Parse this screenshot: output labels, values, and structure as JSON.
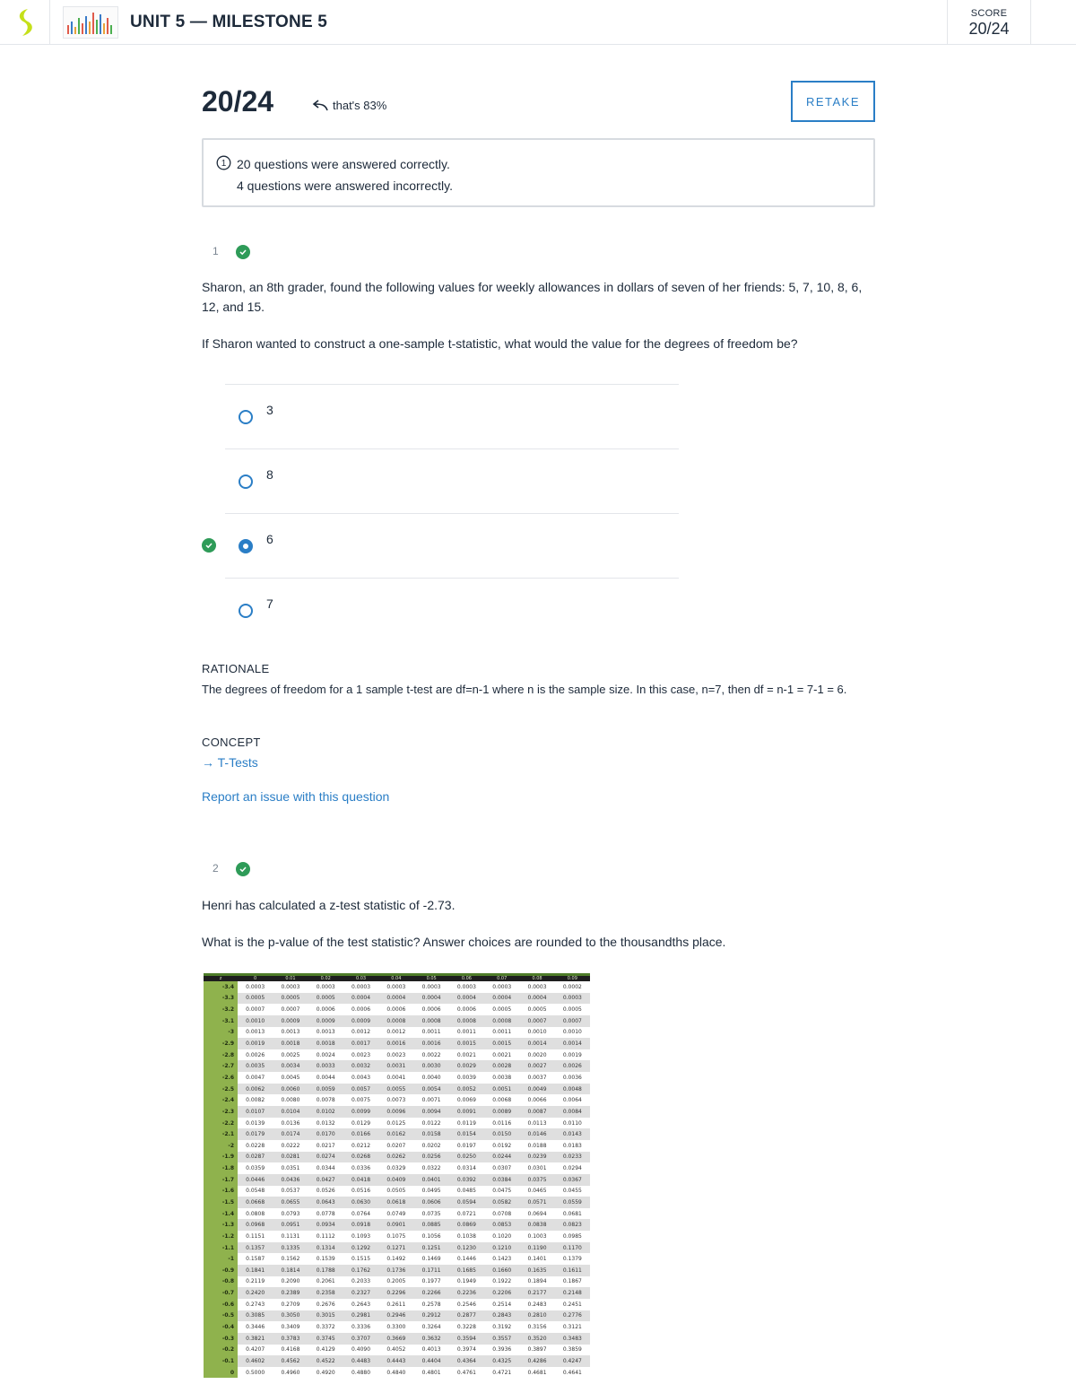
{
  "header": {
    "title": "UNIT 5 — MILESTONE 5",
    "score_label": "SCORE",
    "score_value": "20/24"
  },
  "result": {
    "score": "20/24",
    "percent_note": "that's 83%",
    "retake_label": "RETAKE",
    "correct_text": "20 questions were answered correctly.",
    "incorrect_text": "4 questions were answered incorrectly."
  },
  "question1": {
    "number": "1",
    "text": "Sharon, an 8th grader, found the following values for weekly allowances in dollars of seven of her friends: 5, 7, 10, 8, 6, 12, and 15.",
    "prompt": "If Sharon wanted to construct a one-sample t-statistic, what would the value for the degrees of freedom be?",
    "options": [
      {
        "label": "3",
        "selected": false
      },
      {
        "label": "8",
        "selected": false
      },
      {
        "label": "6",
        "selected": true
      },
      {
        "label": "7",
        "selected": false
      }
    ],
    "rationale_label": "RATIONALE",
    "rationale": "The degrees of freedom for a 1 sample t-test are df=n-1 where n is the sample size.  In this case, n=7, then df = n-1 = 7-1 = 6.",
    "concept_label": "CONCEPT",
    "concept_link": "T-Tests",
    "report_link": "Report an issue with this question"
  },
  "question2": {
    "number": "2",
    "text": "Henri has calculated a z-test statistic of -2.73.",
    "prompt": "What is the p-value of the test statistic?  Answer choices are rounded to the thousandths place."
  },
  "ztable": {
    "headers": [
      "z",
      "0",
      "0.01",
      "0.02",
      "0.03",
      "0.04",
      "0.05",
      "0.06",
      "0.07",
      "0.08",
      "0.09"
    ],
    "rows": [
      [
        "-3.4",
        "0.0003",
        "0.0003",
        "0.0003",
        "0.0003",
        "0.0003",
        "0.0003",
        "0.0003",
        "0.0003",
        "0.0003",
        "0.0002"
      ],
      [
        "-3.3",
        "0.0005",
        "0.0005",
        "0.0005",
        "0.0004",
        "0.0004",
        "0.0004",
        "0.0004",
        "0.0004",
        "0.0004",
        "0.0003"
      ],
      [
        "-3.2",
        "0.0007",
        "0.0007",
        "0.0006",
        "0.0006",
        "0.0006",
        "0.0006",
        "0.0006",
        "0.0005",
        "0.0005",
        "0.0005"
      ],
      [
        "-3.1",
        "0.0010",
        "0.0009",
        "0.0009",
        "0.0009",
        "0.0008",
        "0.0008",
        "0.0008",
        "0.0008",
        "0.0007",
        "0.0007"
      ],
      [
        "-3",
        "0.0013",
        "0.0013",
        "0.0013",
        "0.0012",
        "0.0012",
        "0.0011",
        "0.0011",
        "0.0011",
        "0.0010",
        "0.0010"
      ],
      [
        "-2.9",
        "0.0019",
        "0.0018",
        "0.0018",
        "0.0017",
        "0.0016",
        "0.0016",
        "0.0015",
        "0.0015",
        "0.0014",
        "0.0014"
      ],
      [
        "-2.8",
        "0.0026",
        "0.0025",
        "0.0024",
        "0.0023",
        "0.0023",
        "0.0022",
        "0.0021",
        "0.0021",
        "0.0020",
        "0.0019"
      ],
      [
        "-2.7",
        "0.0035",
        "0.0034",
        "0.0033",
        "0.0032",
        "0.0031",
        "0.0030",
        "0.0029",
        "0.0028",
        "0.0027",
        "0.0026"
      ],
      [
        "-2.6",
        "0.0047",
        "0.0045",
        "0.0044",
        "0.0043",
        "0.0041",
        "0.0040",
        "0.0039",
        "0.0038",
        "0.0037",
        "0.0036"
      ],
      [
        "-2.5",
        "0.0062",
        "0.0060",
        "0.0059",
        "0.0057",
        "0.0055",
        "0.0054",
        "0.0052",
        "0.0051",
        "0.0049",
        "0.0048"
      ],
      [
        "-2.4",
        "0.0082",
        "0.0080",
        "0.0078",
        "0.0075",
        "0.0073",
        "0.0071",
        "0.0069",
        "0.0068",
        "0.0066",
        "0.0064"
      ],
      [
        "-2.3",
        "0.0107",
        "0.0104",
        "0.0102",
        "0.0099",
        "0.0096",
        "0.0094",
        "0.0091",
        "0.0089",
        "0.0087",
        "0.0084"
      ],
      [
        "-2.2",
        "0.0139",
        "0.0136",
        "0.0132",
        "0.0129",
        "0.0125",
        "0.0122",
        "0.0119",
        "0.0116",
        "0.0113",
        "0.0110"
      ],
      [
        "-2.1",
        "0.0179",
        "0.0174",
        "0.0170",
        "0.0166",
        "0.0162",
        "0.0158",
        "0.0154",
        "0.0150",
        "0.0146",
        "0.0143"
      ],
      [
        "-2",
        "0.0228",
        "0.0222",
        "0.0217",
        "0.0212",
        "0.0207",
        "0.0202",
        "0.0197",
        "0.0192",
        "0.0188",
        "0.0183"
      ],
      [
        "-1.9",
        "0.0287",
        "0.0281",
        "0.0274",
        "0.0268",
        "0.0262",
        "0.0256",
        "0.0250",
        "0.0244",
        "0.0239",
        "0.0233"
      ],
      [
        "-1.8",
        "0.0359",
        "0.0351",
        "0.0344",
        "0.0336",
        "0.0329",
        "0.0322",
        "0.0314",
        "0.0307",
        "0.0301",
        "0.0294"
      ],
      [
        "-1.7",
        "0.0446",
        "0.0436",
        "0.0427",
        "0.0418",
        "0.0409",
        "0.0401",
        "0.0392",
        "0.0384",
        "0.0375",
        "0.0367"
      ],
      [
        "-1.6",
        "0.0548",
        "0.0537",
        "0.0526",
        "0.0516",
        "0.0505",
        "0.0495",
        "0.0485",
        "0.0475",
        "0.0465",
        "0.0455"
      ],
      [
        "-1.5",
        "0.0668",
        "0.0655",
        "0.0643",
        "0.0630",
        "0.0618",
        "0.0606",
        "0.0594",
        "0.0582",
        "0.0571",
        "0.0559"
      ],
      [
        "-1.4",
        "0.0808",
        "0.0793",
        "0.0778",
        "0.0764",
        "0.0749",
        "0.0735",
        "0.0721",
        "0.0708",
        "0.0694",
        "0.0681"
      ],
      [
        "-1.3",
        "0.0968",
        "0.0951",
        "0.0934",
        "0.0918",
        "0.0901",
        "0.0885",
        "0.0869",
        "0.0853",
        "0.0838",
        "0.0823"
      ],
      [
        "-1.2",
        "0.1151",
        "0.1131",
        "0.1112",
        "0.1093",
        "0.1075",
        "0.1056",
        "0.1038",
        "0.1020",
        "0.1003",
        "0.0985"
      ],
      [
        "-1.1",
        "0.1357",
        "0.1335",
        "0.1314",
        "0.1292",
        "0.1271",
        "0.1251",
        "0.1230",
        "0.1210",
        "0.1190",
        "0.1170"
      ],
      [
        "-1",
        "0.1587",
        "0.1562",
        "0.1539",
        "0.1515",
        "0.1492",
        "0.1469",
        "0.1446",
        "0.1423",
        "0.1401",
        "0.1379"
      ],
      [
        "-0.9",
        "0.1841",
        "0.1814",
        "0.1788",
        "0.1762",
        "0.1736",
        "0.1711",
        "0.1685",
        "0.1660",
        "0.1635",
        "0.1611"
      ],
      [
        "-0.8",
        "0.2119",
        "0.2090",
        "0.2061",
        "0.2033",
        "0.2005",
        "0.1977",
        "0.1949",
        "0.1922",
        "0.1894",
        "0.1867"
      ],
      [
        "-0.7",
        "0.2420",
        "0.2389",
        "0.2358",
        "0.2327",
        "0.2296",
        "0.2266",
        "0.2236",
        "0.2206",
        "0.2177",
        "0.2148"
      ],
      [
        "-0.6",
        "0.2743",
        "0.2709",
        "0.2676",
        "0.2643",
        "0.2611",
        "0.2578",
        "0.2546",
        "0.2514",
        "0.2483",
        "0.2451"
      ],
      [
        "-0.5",
        "0.3085",
        "0.3050",
        "0.3015",
        "0.2981",
        "0.2946",
        "0.2912",
        "0.2877",
        "0.2843",
        "0.2810",
        "0.2776"
      ],
      [
        "-0.4",
        "0.3446",
        "0.3409",
        "0.3372",
        "0.3336",
        "0.3300",
        "0.3264",
        "0.3228",
        "0.3192",
        "0.3156",
        "0.3121"
      ],
      [
        "-0.3",
        "0.3821",
        "0.3783",
        "0.3745",
        "0.3707",
        "0.3669",
        "0.3632",
        "0.3594",
        "0.3557",
        "0.3520",
        "0.3483"
      ],
      [
        "-0.2",
        "0.4207",
        "0.4168",
        "0.4129",
        "0.4090",
        "0.4052",
        "0.4013",
        "0.3974",
        "0.3936",
        "0.3897",
        "0.3859"
      ],
      [
        "-0.1",
        "0.4602",
        "0.4562",
        "0.4522",
        "0.4483",
        "0.4443",
        "0.4404",
        "0.4364",
        "0.4325",
        "0.4286",
        "0.4247"
      ],
      [
        "0",
        "0.5000",
        "0.4960",
        "0.4920",
        "0.4880",
        "0.4840",
        "0.4801",
        "0.4761",
        "0.4721",
        "0.4681",
        "0.4641"
      ]
    ]
  },
  "colors": {
    "accent": "#2a7ec6",
    "correct": "#2e9b58",
    "brand": "#c5e01a"
  }
}
